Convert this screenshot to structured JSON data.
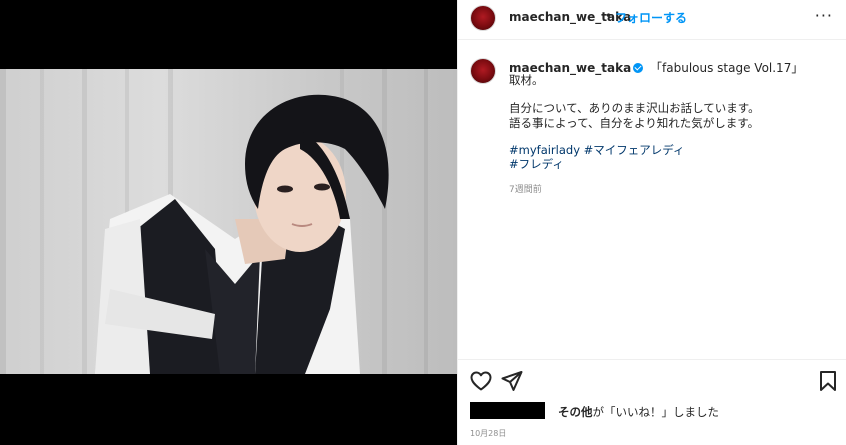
{
  "post": {
    "username": "maechan_we_taka",
    "separator": "•",
    "follow_label": "フォローする",
    "more_label": "···"
  },
  "caption": {
    "username": "maechan_we_taka",
    "line1": "「fabulous stage Vol.17」",
    "line2": "取材。",
    "line3": "自分について、ありのまま沢山お話しています。",
    "line4": "語る事によって、自分をより知れた気がします。",
    "hashtag1": "#myfairlady",
    "hashtag2": "#マイフェアレディ",
    "hashtag3": "#フレディ",
    "time_ago": "7週間前"
  },
  "actions": {
    "like_icon": "heart-outline-icon",
    "share_icon": "paper-plane-icon",
    "save_icon": "bookmark-icon"
  },
  "likes": {
    "prefix_bold": "その他",
    "text": "が「いいね！」しました"
  },
  "date": "10月28日",
  "colors": {
    "link_blue": "#0095f6",
    "hashtag": "#00376b",
    "muted": "#8e8e8e",
    "avatar_red": "#b01a22"
  }
}
